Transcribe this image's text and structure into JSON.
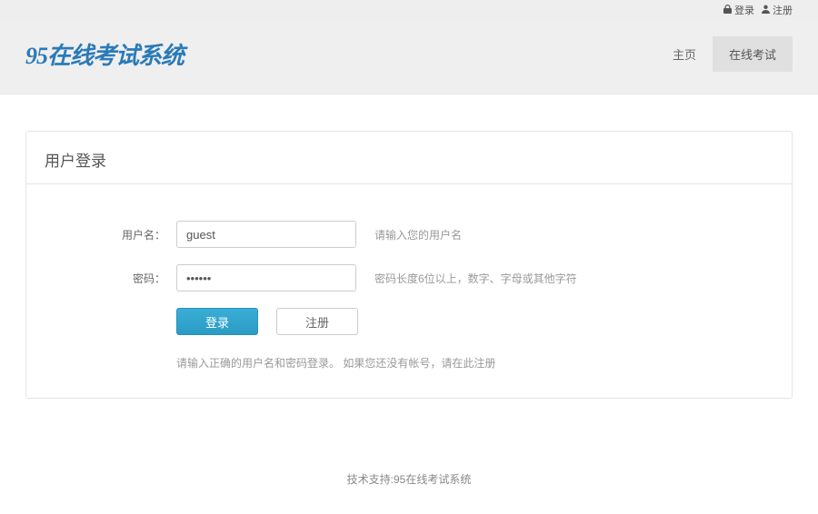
{
  "topbar": {
    "login_label": "登录",
    "register_label": "注册"
  },
  "header": {
    "logo_text": "95在线考试系统",
    "nav": [
      {
        "label": "主页",
        "active": false
      },
      {
        "label": "在线考试",
        "active": true
      }
    ]
  },
  "panel": {
    "title": "用户登录"
  },
  "form": {
    "username_label": "用户名：",
    "username_value": "guest",
    "username_hint": "请输入您的用户名",
    "password_label": "密码：",
    "password_value": "••••••",
    "password_hint": "密码长度6位以上，数字、字母或其他字符",
    "login_button": "登录",
    "register_button": "注册",
    "help_text": "请输入正确的用户名和密码登录。 如果您还没有帐号，请在此注册"
  },
  "footer": {
    "text": "技术支持:95在线考试系统"
  }
}
